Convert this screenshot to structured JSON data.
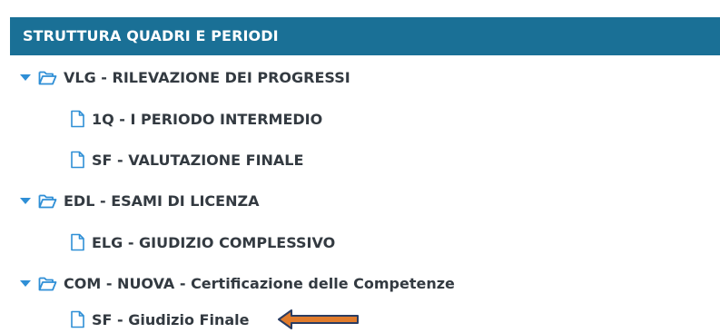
{
  "header": {
    "title": "STRUTTURA QUADRI E PERIODI"
  },
  "tree": {
    "nodes": [
      {
        "label": "VLG - RILEVAZIONE DEI PROGRESSI",
        "type": "folder",
        "expanded": true
      },
      {
        "label": "1Q - I PERIODO INTERMEDIO",
        "type": "file"
      },
      {
        "label": "SF - VALUTAZIONE FINALE",
        "type": "file"
      },
      {
        "label": "EDL - ESAMI DI LICENZA",
        "type": "folder",
        "expanded": true
      },
      {
        "label": "ELG - GIUDIZIO COMPLESSIVO",
        "type": "file"
      },
      {
        "label": "COM - NUOVA - Certificazione delle Competenze",
        "type": "folder",
        "expanded": true
      },
      {
        "label": "SF - Giudizio Finale",
        "type": "file"
      }
    ]
  },
  "icons": {
    "caret": "caret-down-icon",
    "folder": "folder-open-icon",
    "file": "file-icon",
    "pointer": "arrow-left-icon"
  },
  "colors": {
    "header_bg": "#1a7096",
    "header_text": "#ffffff",
    "row_text": "#333a41",
    "icon_blue": "#2f8fd6",
    "arrow_fill": "#e07b2c",
    "arrow_stroke": "#2a3d63"
  }
}
